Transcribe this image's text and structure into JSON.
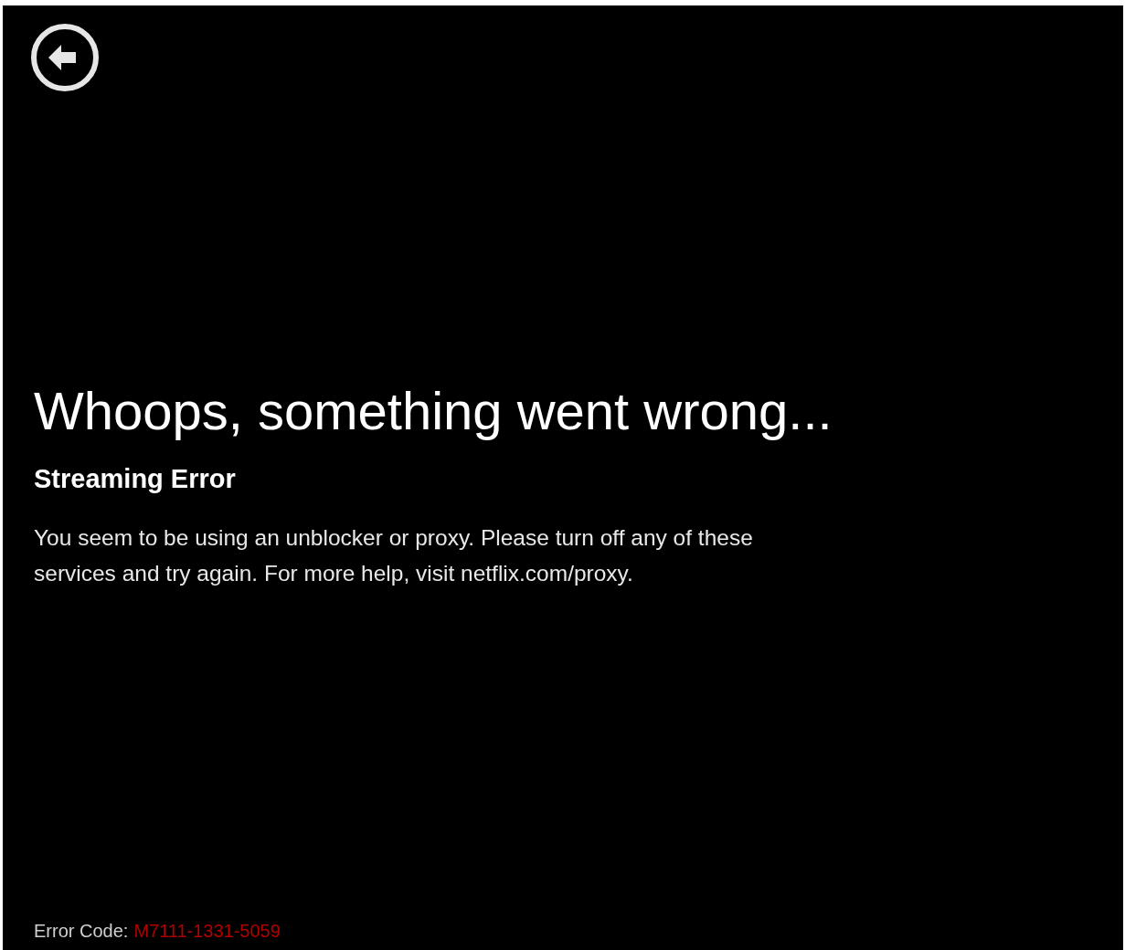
{
  "back_button": {
    "kind": "back"
  },
  "heading": "Whoops, something went wrong...",
  "subtitle": "Streaming Error",
  "message": "You seem to be using an unblocker or proxy. Please turn off any of these services and try again. For more help, visit netflix.com/proxy.",
  "error_code": {
    "label": "Error Code:",
    "value": "M7111-1331-5059"
  }
}
